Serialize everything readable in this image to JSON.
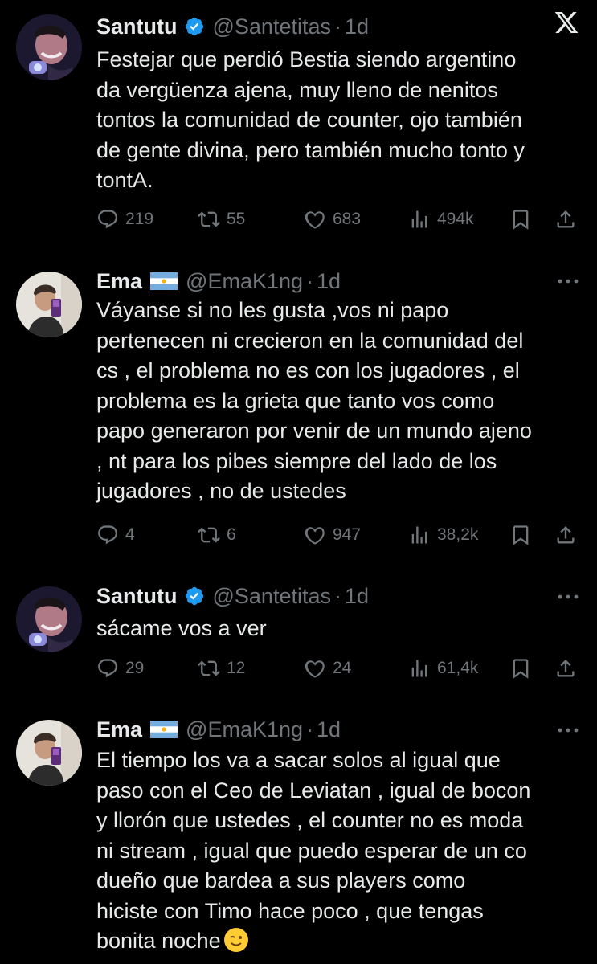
{
  "tweets": [
    {
      "name": "Santutu",
      "verified": true,
      "handle": "@Santetitas",
      "time": "1d",
      "text": "Festejar que perdió Bestia siendo argentino\nda vergüenza ajena, muy lleno de nenitos\ntontos la comunidad de counter, ojo también\nde gente divina, pero también mucho tonto y\ntontA.",
      "replies": "219",
      "retweets": "55",
      "likes": "683",
      "views": "494k"
    },
    {
      "name": "Ema",
      "flag": "argentina-flag",
      "handle": "@EmaK1ng",
      "time": "1d",
      "text": "Váyanse si no les gusta ,vos ni papo\npertenecen ni crecieron en la comunidad del\ncs , el problema no es con los jugadores , el\nproblema es la grieta que tanto vos como\npapo generaron por venir de un mundo ajeno\n, nt para los pibes siempre del lado de los\njugadores , no de ustedes",
      "replies": "4",
      "retweets": "6",
      "likes": "947",
      "views": "38,2k"
    },
    {
      "name": "Santutu",
      "verified": true,
      "handle": "@Santetitas",
      "time": "1d",
      "text": "sácame vos a ver",
      "replies": "29",
      "retweets": "12",
      "likes": "24",
      "views": "61,4k"
    },
    {
      "name": "Ema",
      "flag": "argentina-flag",
      "handle": "@EmaK1ng",
      "time": "1d",
      "text": "El tiempo los va a sacar solos al igual que\npaso con el Ceo de Leviatan , igual de bocon\ny llorón que ustedes , el counter no es moda\nni stream , igual que puedo esperar de un co\ndueño que bardea a sus players como\nhiciste con Timo hace poco , que tengas\nbonita noche",
      "emoji": "winking-face-emoji"
    }
  ],
  "icons": {
    "close": "x-logo-icon",
    "more": "more-dots-icon"
  },
  "colors": {
    "background": "#000000",
    "text": "#e7e9ea",
    "secondary": "#71767b",
    "verified": "#1d9bf0"
  }
}
